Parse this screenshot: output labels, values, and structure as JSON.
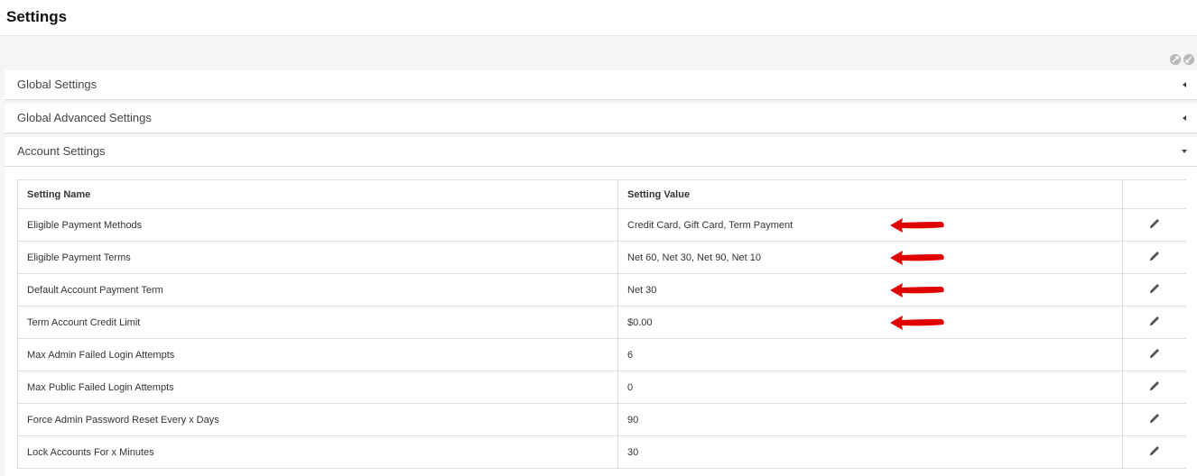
{
  "page": {
    "title": "Settings"
  },
  "panels": [
    {
      "title": "Global Settings",
      "state": "collapsed"
    },
    {
      "title": "Global Advanced Settings",
      "state": "collapsed"
    },
    {
      "title": "Account Settings",
      "state": "expanded"
    }
  ],
  "table": {
    "headers": [
      "Setting Name",
      "Setting Value",
      ""
    ],
    "rows": [
      {
        "name": "Eligible Payment Methods",
        "value": "Credit Card, Gift Card, Term Payment",
        "annotated": true
      },
      {
        "name": "Eligible Payment Terms",
        "value": "Net 60, Net 30, Net 90, Net 10",
        "annotated": true
      },
      {
        "name": "Default Account Payment Term",
        "value": "Net 30",
        "annotated": true
      },
      {
        "name": "Term Account Credit Limit",
        "value": "$0.00",
        "annotated": true
      },
      {
        "name": "Max Admin Failed Login Attempts",
        "value": "6",
        "annotated": false
      },
      {
        "name": "Max Public Failed Login Attempts",
        "value": "0",
        "annotated": false
      },
      {
        "name": "Force Admin Password Reset Every x Days",
        "value": "90",
        "annotated": false
      },
      {
        "name": "Lock Accounts For x Minutes",
        "value": "30",
        "annotated": false
      }
    ]
  },
  "icons": {
    "caret_collapsed": "caret-left-icon",
    "caret_expanded": "caret-down-icon",
    "edit": "pencil-icon",
    "annotation": "red-arrow-icon"
  },
  "colors": {
    "annotation_arrow": "#e00000",
    "caret": "#444444",
    "page_background": "#f5f5f5"
  }
}
